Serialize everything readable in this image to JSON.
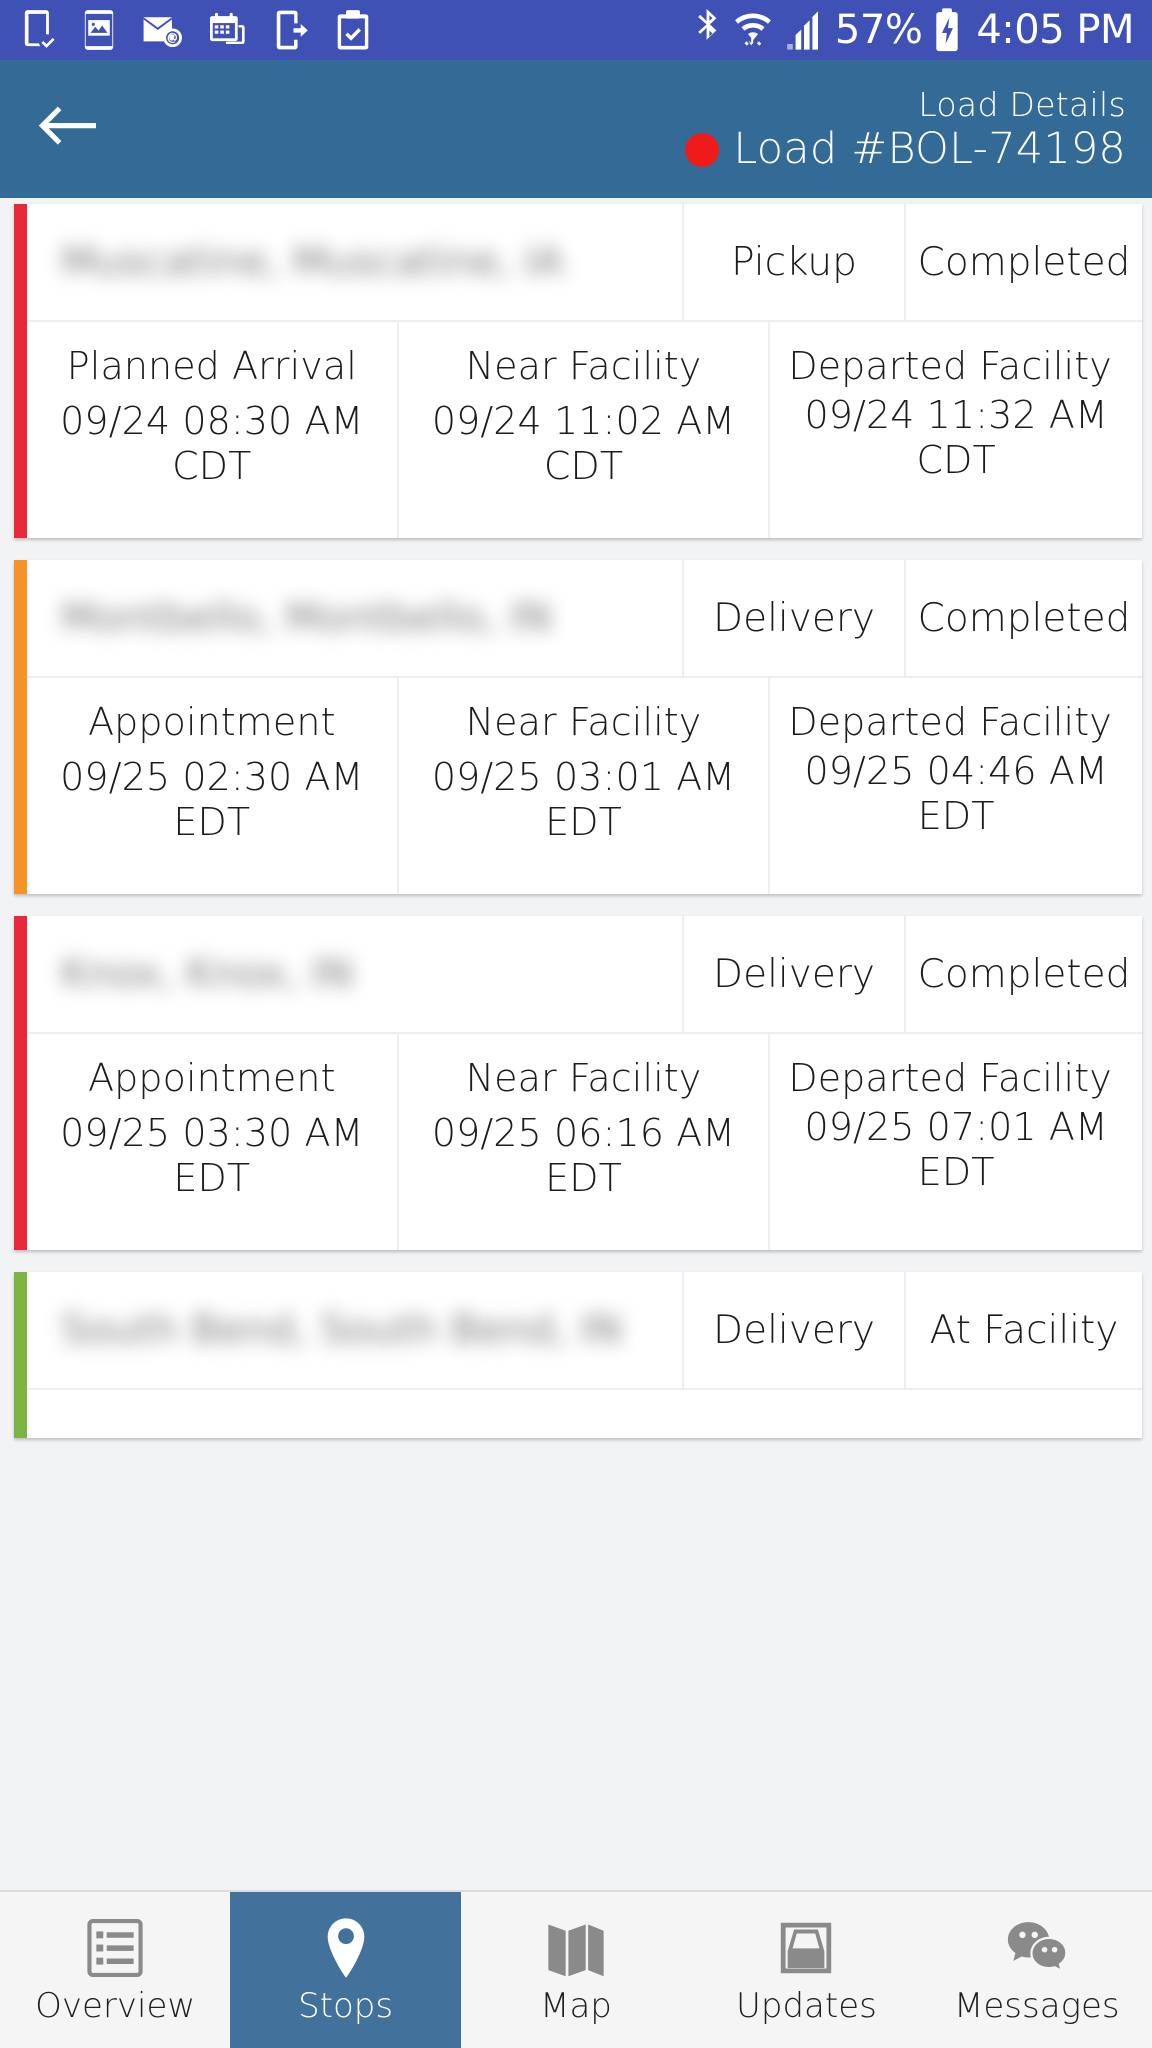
{
  "status_bar": {
    "icons_left": [
      "device-download-icon",
      "image-icon",
      "mail-send-icon",
      "calendar-icon",
      "device-login-icon",
      "clipboard-check-icon"
    ],
    "bluetooth_icon": "bluetooth-icon",
    "wifi_icon": "wifi-icon",
    "signal_icon": "cellular-signal-icon",
    "battery_percent": "57%",
    "battery_icon": "battery-charging-icon",
    "clock": "4:05 PM",
    "background_color": "#3f51b5"
  },
  "header": {
    "back_icon": "back-arrow-icon",
    "subtitle": "Load Details",
    "status_dot_color": "#ef1b1b",
    "status_dot_name": "load-status-dot",
    "load_id": "Load #BOL-74198",
    "background_color": "#336b96"
  },
  "stops": [
    {
      "accent_color": "#e8283b",
      "location": "Muscatine, Muscatine, IA",
      "type": "Pickup",
      "state": "Completed",
      "columns": [
        {
          "label": "Planned Arrival",
          "value": "09/24 08:30 AM CDT",
          "align": "center"
        },
        {
          "label": "Near Facility",
          "value": "09/24 11:02 AM CDT",
          "align": "center"
        },
        {
          "label": "Departed Facility",
          "value": "09/24 11:32 AM CDT",
          "align": "left"
        }
      ]
    },
    {
      "accent_color": "#f79226",
      "location": "Montbello, Montbello, IN",
      "type": "Delivery",
      "state": "Completed",
      "columns": [
        {
          "label": "Appointment",
          "value": "09/25 02:30 AM EDT",
          "align": "center"
        },
        {
          "label": "Near Facility",
          "value": "09/25 03:01 AM EDT",
          "align": "center"
        },
        {
          "label": "Departed Facility",
          "value": "09/25 04:46 AM EDT",
          "align": "left"
        }
      ]
    },
    {
      "accent_color": "#e8283b",
      "location": "Knox, Knox, IN",
      "type": "Delivery",
      "state": "Completed",
      "columns": [
        {
          "label": "Appointment",
          "value": "09/25 03:30 AM EDT",
          "align": "center"
        },
        {
          "label": "Near Facility",
          "value": "09/25 06:16 AM EDT",
          "align": "center"
        },
        {
          "label": "Departed Facility",
          "value": "09/25 07:01 AM EDT",
          "align": "left"
        }
      ]
    },
    {
      "accent_color": "#7cb342",
      "location": "South Bend, South Bend, IN",
      "type": "Delivery",
      "state": "At Facility",
      "columns": []
    }
  ],
  "bottom_nav": {
    "active_index": 1,
    "active_background": "#42719b",
    "items": [
      {
        "label": "Overview",
        "icon": "list-overview-icon"
      },
      {
        "label": "Stops",
        "icon": "map-pin-icon"
      },
      {
        "label": "Map",
        "icon": "folded-map-icon"
      },
      {
        "label": "Updates",
        "icon": "inbox-tray-icon"
      },
      {
        "label": "Messages",
        "icon": "chat-bubbles-icon"
      }
    ]
  }
}
